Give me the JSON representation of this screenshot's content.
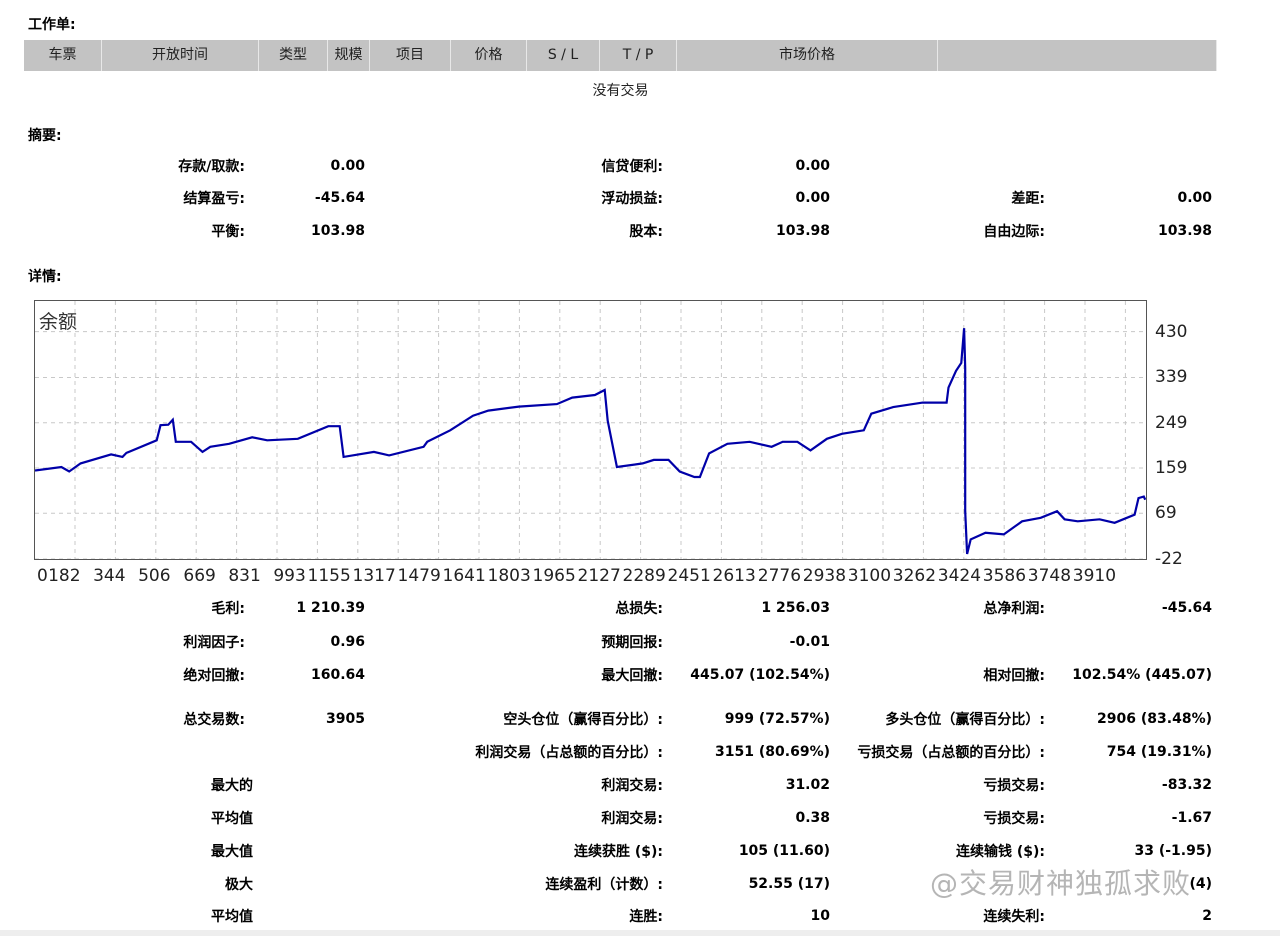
{
  "orders": {
    "title": "工作单:",
    "columns": [
      "车票",
      "开放时间",
      "类型",
      "规模",
      "项目",
      "价格",
      "S / L",
      "T / P",
      "市场价格",
      ""
    ],
    "empty_text": "没有交易"
  },
  "summary": {
    "title": "摘要:",
    "rows": [
      [
        {
          "label": "存款/取款:",
          "value": "0.00"
        },
        {
          "label": "信贷便利:",
          "value": "0.00"
        },
        null
      ],
      [
        {
          "label": "结算盈亏:",
          "value": "-45.64"
        },
        {
          "label": "浮动损益:",
          "value": "0.00"
        },
        {
          "label": "差距:",
          "value": "0.00"
        }
      ],
      [
        {
          "label": "平衡:",
          "value": "103.98"
        },
        {
          "label": "股本:",
          "value": "103.98"
        },
        {
          "label": "自由边际:",
          "value": "103.98"
        }
      ]
    ]
  },
  "details": {
    "title": "详情:",
    "rows": [
      [
        {
          "label": "毛利:",
          "value": "1 210.39"
        },
        {
          "label": "总损失:",
          "value": "1 256.03"
        },
        {
          "label": "总净利润:",
          "value": "-45.64"
        }
      ],
      [
        {
          "label": "利润因子:",
          "value": "0.96"
        },
        {
          "label": "预期回报:",
          "value": "-0.01"
        },
        null
      ],
      [
        {
          "label": "绝对回撤:",
          "value": "160.64"
        },
        {
          "label": "最大回撤:",
          "value": "445.07 (102.54%)"
        },
        {
          "label": "相对回撤:",
          "value": "102.54% (445.07)"
        }
      ],
      [
        {
          "label": "总交易数:",
          "value": "3905"
        },
        {
          "label": "空头仓位（赢得百分比）:",
          "value": "999 (72.57%)"
        },
        {
          "label": "多头仓位（赢得百分比）:",
          "value": "2906 (83.48%)"
        }
      ],
      [
        null,
        {
          "label": "利润交易（占总额的百分比）:",
          "value": "3151 (80.69%)"
        },
        {
          "label": "亏损交易（占总额的百分比）:",
          "value": "754 (19.31%)"
        }
      ],
      [
        {
          "label": "最大的",
          "value": ""
        },
        {
          "label": "利润交易:",
          "value": "31.02"
        },
        {
          "label": "亏损交易:",
          "value": "-83.32"
        }
      ],
      [
        {
          "label": "平均值",
          "value": ""
        },
        {
          "label": "利润交易:",
          "value": "0.38"
        },
        {
          "label": "亏损交易:",
          "value": "-1.67"
        }
      ],
      [
        {
          "label": "最大值",
          "value": ""
        },
        {
          "label": "连续获胜 ($):",
          "value": "105 (11.60)"
        },
        {
          "label": "连续输钱 ($):",
          "value": "33 (-1.95)"
        }
      ],
      [
        {
          "label": "极大",
          "value": ""
        },
        {
          "label": "连续盈利（计数）:",
          "value": "52.55 (17)"
        },
        {
          "label": "",
          "value": "(4)"
        }
      ],
      [
        {
          "label": "平均值",
          "value": ""
        },
        {
          "label": "连胜:",
          "value": "10"
        },
        {
          "label": "连续失利:",
          "value": "2"
        }
      ]
    ]
  },
  "watermark": "@交易财神独孤求败",
  "chart_data": {
    "type": "line",
    "title": "余额",
    "line_color": "#0000a8",
    "grid": true,
    "xlim": [
      0,
      4000
    ],
    "ylim": [
      -22,
      491
    ],
    "yticks": [
      430,
      339,
      249,
      159,
      69,
      -22
    ],
    "xticks": [
      0,
      182,
      344,
      506,
      669,
      831,
      993,
      1155,
      1317,
      1479,
      1641,
      1803,
      1965,
      2127,
      2289,
      2451,
      2613,
      2776,
      2938,
      3100,
      3262,
      3424,
      3586,
      3748,
      3910
    ],
    "series": [
      {
        "points": [
          [
            0,
            154
          ],
          [
            95,
            161
          ],
          [
            123,
            152
          ],
          [
            164,
            168
          ],
          [
            274,
            186
          ],
          [
            315,
            181
          ],
          [
            329,
            189
          ],
          [
            438,
            214
          ],
          [
            452,
            244
          ],
          [
            480,
            245
          ],
          [
            496,
            255
          ],
          [
            507,
            211
          ],
          [
            562,
            211
          ],
          [
            603,
            191
          ],
          [
            631,
            201
          ],
          [
            699,
            207
          ],
          [
            782,
            220
          ],
          [
            836,
            214
          ],
          [
            946,
            217
          ],
          [
            1056,
            242
          ],
          [
            1097,
            242
          ],
          [
            1111,
            181
          ],
          [
            1220,
            191
          ],
          [
            1275,
            184
          ],
          [
            1399,
            201
          ],
          [
            1412,
            211
          ],
          [
            1495,
            234
          ],
          [
            1577,
            263
          ],
          [
            1632,
            273
          ],
          [
            1742,
            281
          ],
          [
            1879,
            286
          ],
          [
            1934,
            299
          ],
          [
            2016,
            304
          ],
          [
            2051,
            314
          ],
          [
            2062,
            253
          ],
          [
            2095,
            161
          ],
          [
            2188,
            168
          ],
          [
            2228,
            175
          ],
          [
            2281,
            175
          ],
          [
            2321,
            152
          ],
          [
            2374,
            141
          ],
          [
            2394,
            141
          ],
          [
            2427,
            188
          ],
          [
            2493,
            207
          ],
          [
            2573,
            211
          ],
          [
            2652,
            201
          ],
          [
            2692,
            211
          ],
          [
            2745,
            211
          ],
          [
            2792,
            194
          ],
          [
            2851,
            217
          ],
          [
            2905,
            227
          ],
          [
            2984,
            234
          ],
          [
            3011,
            267
          ],
          [
            3090,
            280
          ],
          [
            3196,
            289
          ],
          [
            3282,
            289
          ],
          [
            3289,
            319
          ],
          [
            3316,
            352
          ],
          [
            3335,
            368
          ],
          [
            3345,
            437
          ],
          [
            3349,
            358
          ],
          [
            3349,
            73
          ],
          [
            3356,
            -12
          ],
          [
            3369,
            17
          ],
          [
            3422,
            30
          ],
          [
            3488,
            27
          ],
          [
            3554,
            53
          ],
          [
            3621,
            60
          ],
          [
            3680,
            73
          ],
          [
            3707,
            57
          ],
          [
            3754,
            53
          ],
          [
            3833,
            57
          ],
          [
            3887,
            50
          ],
          [
            3959,
            66
          ],
          [
            3973,
            99
          ],
          [
            3992,
            102
          ],
          [
            3997,
            96
          ]
        ]
      }
    ]
  }
}
